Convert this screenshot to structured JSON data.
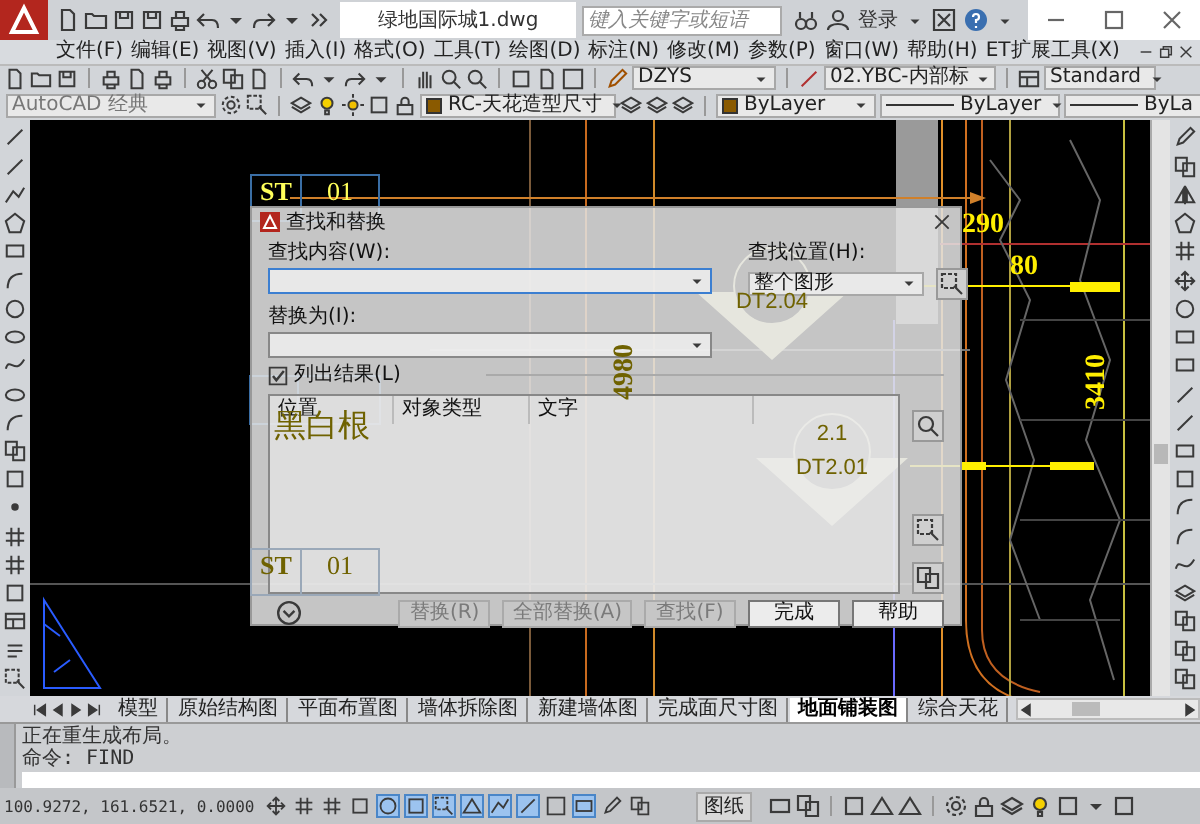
{
  "title_bar": {
    "title": "绿地国际城1.dwg",
    "search": {
      "placeholder": "键入关键字或短语"
    },
    "sign_in": "登录"
  },
  "menu": [
    "文件(F)",
    "编辑(E)",
    "视图(V)",
    "插入(I)",
    "格式(O)",
    "工具(T)",
    "绘图(D)",
    "标注(N)",
    "修改(M)",
    "参数(P)",
    "窗口(W)",
    "帮助(H)",
    "ET扩展工具(X)"
  ],
  "toolbar": {
    "text_style": "DZYS",
    "dimension_style": "02.YBC-内部标",
    "table_style": "Standard"
  },
  "properties_bar": {
    "workspace": "AutoCAD 经典",
    "layer": "RC-天花造型尺寸",
    "color_setting": "ByLayer",
    "linetype": "ByLayer",
    "lineweight": "ByLa"
  },
  "drawing": {
    "labels": [
      {
        "kind": "tag",
        "code": "ST",
        "number": "01",
        "behind_dialog": false
      },
      {
        "kind": "dimension",
        "text": "290",
        "behind_dialog": false
      },
      {
        "kind": "dimension",
        "text": "80",
        "behind_dialog": false
      },
      {
        "kind": "vertical_dimension",
        "text": "3410",
        "behind_dialog": false
      },
      {
        "kind": "vertical_dimension",
        "text": "4980",
        "behind_dialog": true
      },
      {
        "kind": "note",
        "text": "黑白根",
        "behind_dialog": true
      },
      {
        "kind": "symbol",
        "reference": "DT2.04",
        "behind_dialog": true
      },
      {
        "kind": "symbol",
        "number": "2.1",
        "reference": "DT2.01",
        "behind_dialog": true
      },
      {
        "kind": "tag",
        "code": "ST",
        "number": "01",
        "behind_dialog": true
      }
    ]
  },
  "dialog": {
    "title": "查找和替换",
    "find": {
      "label": "查找内容(W):",
      "focused": true
    },
    "replace": {
      "label": "替换为(I):",
      "focused": false
    },
    "location": {
      "label": "查找位置(H):",
      "value": "整个图形"
    },
    "list_results": {
      "label": "列出结果(L)",
      "checked": true
    },
    "columns": [
      "位置",
      "对象类型",
      "文字"
    ],
    "buttons": [
      {
        "label": "替换(R)",
        "disabled": true
      },
      {
        "label": "全部替换(A)",
        "disabled": true
      },
      {
        "label": "查找(F)",
        "disabled": true
      },
      {
        "label": "完成",
        "disabled": false
      },
      {
        "label": "帮助",
        "disabled": false
      }
    ]
  },
  "layout_tabs": [
    {
      "label": "模型",
      "selected": false
    },
    {
      "label": "原始结构图",
      "selected": false
    },
    {
      "label": "平面布置图",
      "selected": false
    },
    {
      "label": "墙体拆除图",
      "selected": false
    },
    {
      "label": "新建墙体图",
      "selected": false
    },
    {
      "label": "完成面尺寸图",
      "selected": false
    },
    {
      "label": "地面铺装图",
      "selected": true
    },
    {
      "label": "综合天花",
      "selected": false
    }
  ],
  "command_line": {
    "history": [
      "正在重生成布局。",
      "命令: FIND"
    ]
  },
  "status_bar": {
    "coordinates": "100.9272, 161.6521, 0.0000",
    "toggles": [
      {
        "on": false
      },
      {
        "on": false
      },
      {
        "on": false
      },
      {
        "on": false
      },
      {
        "on": true
      },
      {
        "on": true
      },
      {
        "on": true
      },
      {
        "on": true
      },
      {
        "on": true
      },
      {
        "on": true
      },
      {
        "on": false
      },
      {
        "on": true
      },
      {
        "on": false
      },
      {
        "on": false
      }
    ],
    "paper_space": "图纸"
  }
}
